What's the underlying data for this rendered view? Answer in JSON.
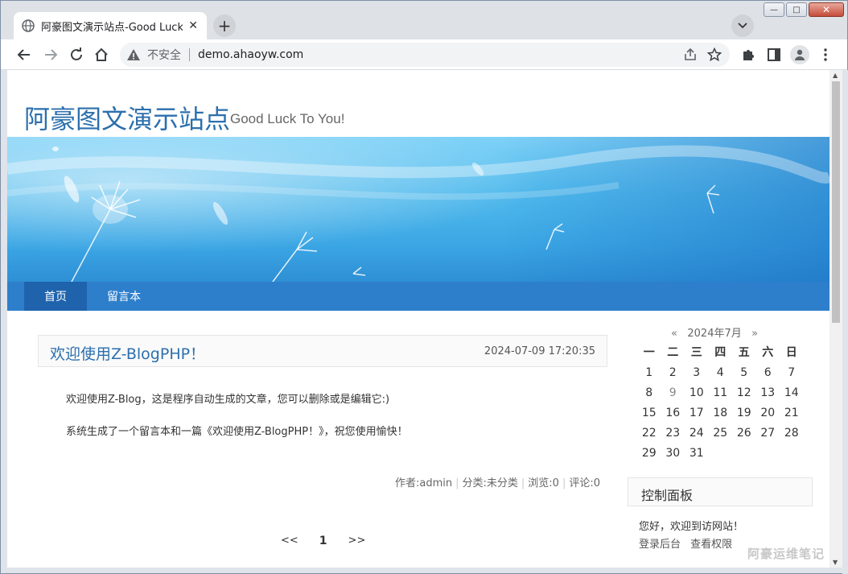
{
  "browser": {
    "tab_title": "阿豪图文演示站点-Good Luck To You!",
    "tab_close": "✕",
    "new_tab": "+",
    "security_label": "不安全",
    "url": "demo.ahaoyw.com",
    "window_buttons": {
      "minimize": "—",
      "maximize": "□",
      "close": "✕"
    }
  },
  "site": {
    "title": "阿豪图文演示站点",
    "subtitle": "Good Luck To You!"
  },
  "nav": {
    "items": [
      {
        "label": "首页",
        "active": true
      },
      {
        "label": "留言本",
        "active": false
      }
    ]
  },
  "post": {
    "title": "欢迎使用Z-BlogPHP！",
    "date": "2024-07-09 17:20:35",
    "paragraphs": [
      "欢迎使用Z-Blog，这是程序自动生成的文章，您可以删除或是编辑它:)",
      "系统生成了一个留言本和一篇《欢迎使用Z-BlogPHP！》，祝您使用愉快！"
    ],
    "meta": {
      "author": "作者:admin",
      "category": "分类:未分类",
      "views": "浏览:0",
      "comments": "评论:0"
    }
  },
  "pager": {
    "prev": "<<",
    "current": "1",
    "next": ">>"
  },
  "calendar": {
    "prev": "«",
    "month": "2024年7月",
    "next": "»",
    "weekdays": [
      "一",
      "二",
      "三",
      "四",
      "五",
      "六",
      "日"
    ],
    "weeks": [
      [
        "1",
        "2",
        "3",
        "4",
        "5",
        "6",
        "7"
      ],
      [
        "8",
        "9",
        "10",
        "11",
        "12",
        "13",
        "14"
      ],
      [
        "15",
        "16",
        "17",
        "18",
        "19",
        "20",
        "21"
      ],
      [
        "22",
        "23",
        "24",
        "25",
        "26",
        "27",
        "28"
      ],
      [
        "29",
        "30",
        "31",
        "",
        "",
        "",
        ""
      ]
    ],
    "today": "9"
  },
  "control_panel": {
    "title": "控制面板",
    "greeting": "您好，欢迎到访网站！",
    "links": [
      "登录后台",
      "查看权限"
    ]
  },
  "watermark": "阿豪运维笔记",
  "colors": {
    "brand": "#2c6fad",
    "nav_bg": "#2e7fcb",
    "nav_active": "#1f63ad"
  }
}
